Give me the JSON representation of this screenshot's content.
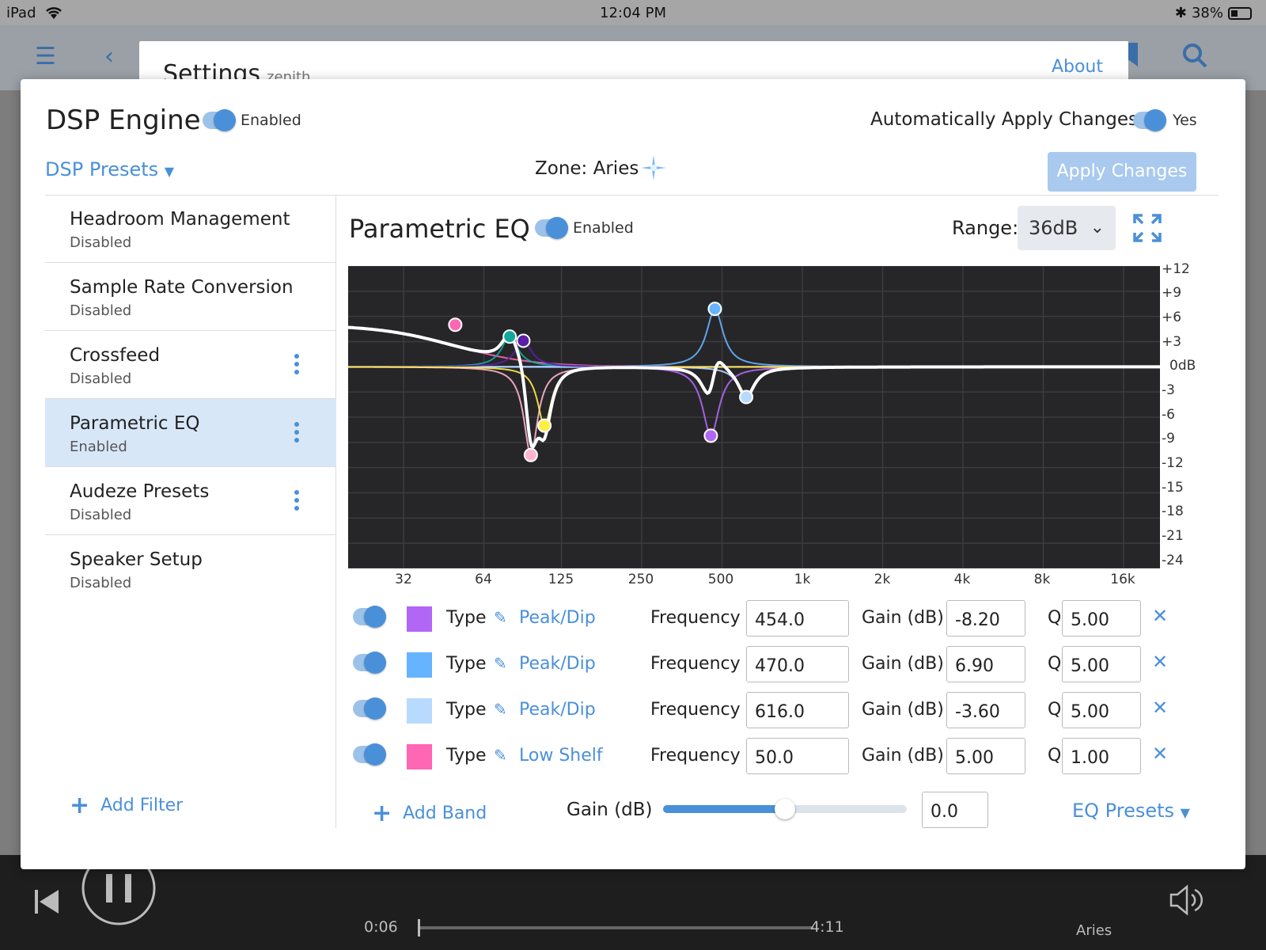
{
  "status": {
    "device": "iPad",
    "time": "12:04 PM",
    "battery": "38%"
  },
  "background": {
    "settings_title": "Settings",
    "settings_subtitle": "zenith",
    "about": "About",
    "zone_label": "Aries",
    "elapsed": "0:06",
    "duration": "4:11"
  },
  "dsp": {
    "title": "DSP Engine",
    "enabled_label": "Enabled",
    "auto_apply_label": "Automatically Apply Changes",
    "auto_apply_value": "Yes",
    "presets_label": "DSP Presets",
    "zone": "Zone: Aries",
    "apply_button": "Apply Changes"
  },
  "sidebar": {
    "items": [
      {
        "name": "Headroom Management",
        "status": "Disabled"
      },
      {
        "name": "Sample Rate Conversion",
        "status": "Disabled"
      },
      {
        "name": "Crossfeed",
        "status": "Disabled"
      },
      {
        "name": "Parametric EQ",
        "status": "Enabled"
      },
      {
        "name": "Audeze Presets",
        "status": "Disabled"
      },
      {
        "name": "Speaker Setup",
        "status": "Disabled"
      }
    ],
    "add_filter": "Add Filter"
  },
  "peq": {
    "title": "Parametric EQ",
    "enabled_label": "Enabled",
    "range_label": "Range:",
    "range_value": "36dB",
    "y_ticks": [
      "+12",
      "+9",
      "+6",
      "+3",
      "0dB",
      "-3",
      "-6",
      "-9",
      "-12",
      "-15",
      "-18",
      "-21",
      "-24"
    ],
    "x_ticks": [
      "32",
      "64",
      "125",
      "250",
      "500",
      "1k",
      "2k",
      "4k",
      "8k",
      "16k"
    ],
    "bands": [
      {
        "color": "#b266f5",
        "type_label": "Type",
        "type": "Peak/Dip",
        "freq_label": "Frequency",
        "freq": "454.0",
        "gain_label": "Gain (dB)",
        "gain": "-8.20",
        "q_label": "Q",
        "q": "5.00"
      },
      {
        "color": "#66b3ff",
        "type_label": "Type",
        "type": "Peak/Dip",
        "freq_label": "Frequency",
        "freq": "470.0",
        "gain_label": "Gain (dB)",
        "gain": "6.90",
        "q_label": "Q",
        "q": "5.00"
      },
      {
        "color": "#b8daff",
        "type_label": "Type",
        "type": "Peak/Dip",
        "freq_label": "Frequency",
        "freq": "616.0",
        "gain_label": "Gain (dB)",
        "gain": "-3.60",
        "q_label": "Q",
        "q": "5.00"
      },
      {
        "color": "#ff66b3",
        "type_label": "Type",
        "type": "Low Shelf",
        "freq_label": "Frequency",
        "freq": "50.0",
        "gain_label": "Gain (dB)",
        "gain": "5.00",
        "q_label": "Q",
        "q": "1.00"
      }
    ],
    "add_band": "Add Band",
    "master_gain_label": "Gain (dB)",
    "master_gain_value": "0.0",
    "master_gain_fraction": 0.5,
    "eq_presets": "EQ Presets"
  },
  "chart_data": {
    "type": "line",
    "xscale": "log",
    "xlim": [
      20,
      20000
    ],
    "ylim": [
      -24,
      12
    ],
    "grid": true,
    "points": [
      {
        "freq": 50,
        "gain": 5.0,
        "color": "#ff66b3"
      },
      {
        "freq": 80,
        "gain": 3.6,
        "color": "#13a89e"
      },
      {
        "freq": 90,
        "gain": 3.1,
        "color": "#5b1fa8"
      },
      {
        "freq": 96,
        "gain": -10.5,
        "color": "#ffb3d1"
      },
      {
        "freq": 108,
        "gain": -7.0,
        "color": "#ffee44"
      },
      {
        "freq": 470,
        "gain": 6.9,
        "color": "#66b3ff"
      },
      {
        "freq": 454,
        "gain": -8.2,
        "color": "#b266f5"
      },
      {
        "freq": 616,
        "gain": -3.6,
        "color": "#b8daff"
      }
    ]
  }
}
